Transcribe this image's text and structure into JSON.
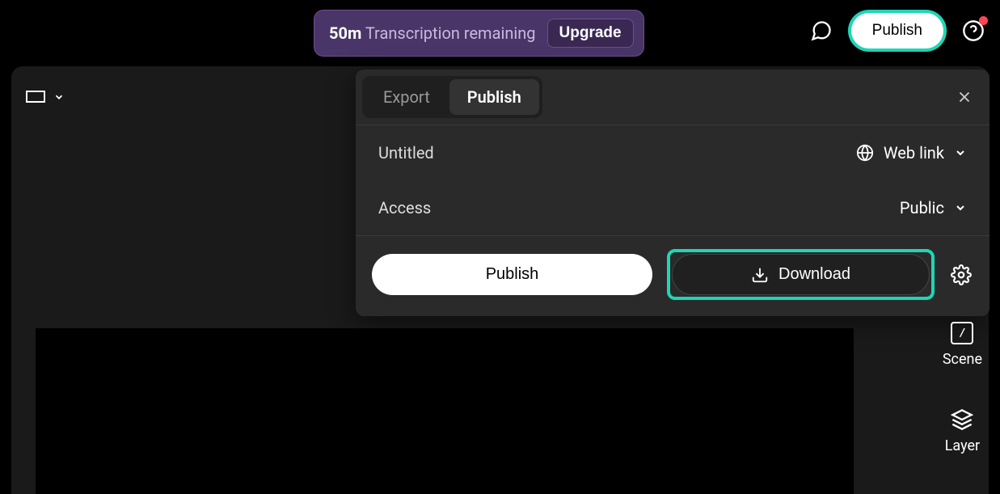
{
  "banner": {
    "time_label": "50m",
    "remaining_label": "Transcription remaining",
    "upgrade_label": "Upgrade"
  },
  "header": {
    "publish_label": "Publish"
  },
  "modal": {
    "tabs": {
      "export": "Export",
      "publish": "Publish"
    },
    "title_label": "Untitled",
    "link_type": "Web link",
    "access_label": "Access",
    "access_value": "Public",
    "publish_button": "Publish",
    "download_button": "Download"
  },
  "sidebar": {
    "scene": "Scene",
    "layer": "Layer"
  }
}
